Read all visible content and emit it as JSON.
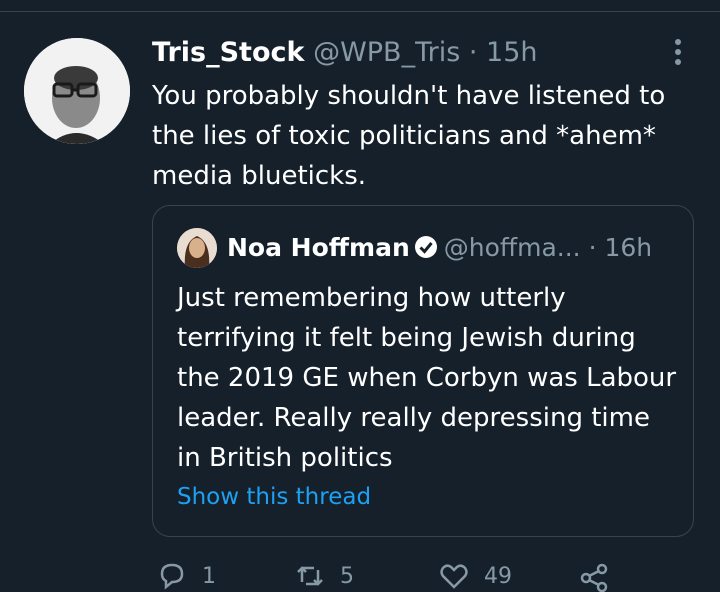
{
  "tweet": {
    "author_name": "Tris_Stock",
    "author_handle": "@WPB_Tris",
    "dot": "·",
    "time": "15h",
    "text": "You probably shouldn't have listened to the lies of toxic politicians and *ahem* media blueticks.",
    "more_icon": "more-vertical-icon"
  },
  "quoted_tweet": {
    "author_name": "Noa Hoffman",
    "author_handle": "@hoffma...",
    "dot": "·",
    "time": "16h",
    "verified_icon": "verified-badge-icon",
    "text": "Just remembering how utterly terrifying it felt being Jewish during the 2019 GE when Corbyn was Labour leader. Really really depressing time in British politics",
    "show_thread_label": "Show this thread"
  },
  "actions": {
    "reply_count": "1",
    "retweet_count": "5",
    "like_count": "49"
  },
  "colors": {
    "background": "#15202b",
    "text_secondary": "#8899a6",
    "accent": "#1da1f2",
    "border": "#38444d"
  }
}
